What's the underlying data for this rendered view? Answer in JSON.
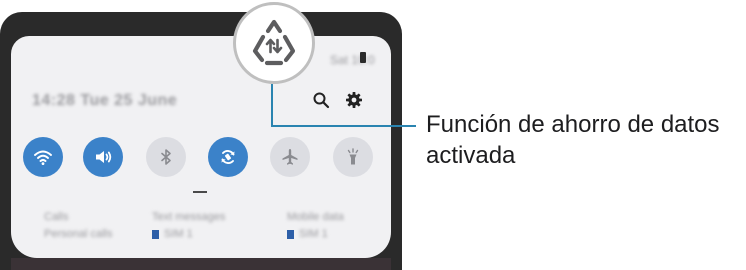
{
  "status_bar": {
    "right_text": "Sat 10:0"
  },
  "panel": {
    "datetime": "14:28 Tue 25 June",
    "top_icons": [
      "search-icon",
      "gear-icon"
    ],
    "tiles": [
      {
        "name": "wifi",
        "state": "on"
      },
      {
        "name": "sound",
        "state": "on"
      },
      {
        "name": "bluetooth",
        "state": "off"
      },
      {
        "name": "auto-rotate",
        "state": "on"
      },
      {
        "name": "airplane",
        "state": "off"
      },
      {
        "name": "flashlight",
        "state": "off"
      }
    ],
    "info": [
      {
        "line1": "Calls",
        "line2": "Personal calls"
      },
      {
        "line1": "Text messages",
        "line2": "SIM 1"
      },
      {
        "line1": "Mobile data",
        "line2": "SIM 1"
      }
    ]
  },
  "callout": {
    "icon": "data-saver-icon",
    "label": "Función de ahorro de datos activada"
  },
  "colors": {
    "accent": "#3b82c9",
    "tile_off": "#dcdde2",
    "panel": "#f1f1f3",
    "frame": "#2a2a2a"
  }
}
